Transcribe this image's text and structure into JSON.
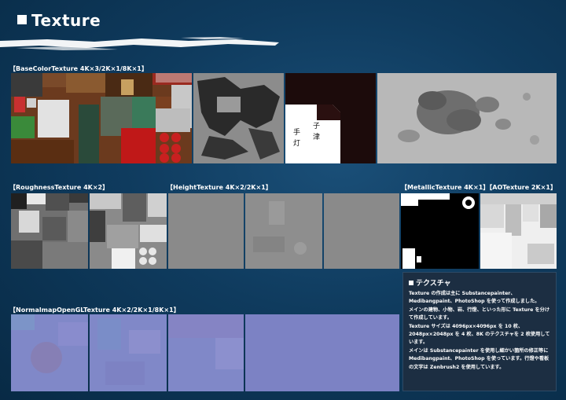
{
  "page": {
    "title": "Texture"
  },
  "sections": {
    "basecolor": "【BaseColorTexture 4K×3/2K×1/8K×1】",
    "roughness": "【RoughnessTexture 4K×2】",
    "height": "【HeightTexture 4K×2/2K×1】",
    "metallic_ao": "【MetallicTexture 4K×1】【AOTexture 2K×1】",
    "normal": "【NormalmapOpenGLTexture 4K×2/2K×1/8K×1】"
  },
  "info": {
    "heading": "テクスチャ",
    "paragraphs": [
      "Texture の作成は主に Substancepainter、Medibangpaint、PhotoShop を使って作成しました。",
      "メインの建物、小物、岩、行燈、といった形に Texture を分けて作成しています。",
      "Texture サイズは 4096px×4096px を 10 枚、2048px×2048px を 4 枚、8K のテクスチャを 2 枚使用しています。",
      "メインは Substancepainter を使用し細かい箇所の修正等に Medibangpaint、PhotoShop を使っています。行燈や看板の文字は Zenbrush2 を使用しています。"
    ]
  },
  "colors": {
    "background": "#0e3a5c",
    "info_box": "#1c2e42",
    "normal_map": "#7f86c8",
    "height_map": "#8a8a8a",
    "moon": "#b5b5b5"
  }
}
